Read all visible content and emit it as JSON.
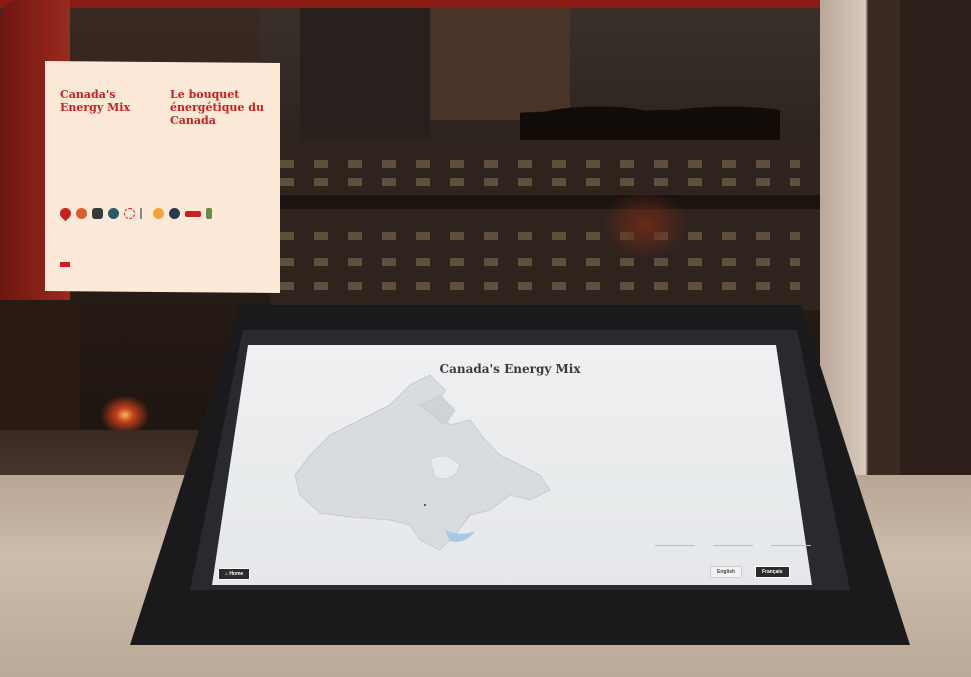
{
  "info_panel": {
    "title_en": "Canada's Energy Mix",
    "title_fr": "Le bouquet énergétique du Canada",
    "text_en": "",
    "text_fr": ""
  },
  "kiosk_screen": {
    "title": "Canada's Energy Mix",
    "description": "",
    "legend": [
      "",
      "",
      ""
    ],
    "home_button": "Home",
    "language_english": "English",
    "language_french": "Français"
  },
  "colors": {
    "booth_red": "#8a1a14",
    "panel_bg": "#fde9d8",
    "panel_title": "#c8201b",
    "screen_bg": "#eef0f1"
  },
  "icons": [
    "oil-drop-icon",
    "gas-flame-icon",
    "coal-icon",
    "globe-icon",
    "nuclear-icon",
    "wind-turbine-icon",
    "sun-icon",
    "hydro-icon",
    "maple-leaf-icon",
    "biomass-icon"
  ]
}
